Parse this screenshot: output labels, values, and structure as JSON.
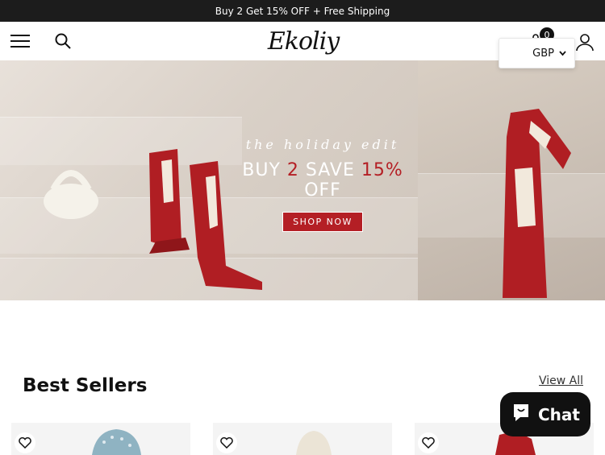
{
  "announcement": {
    "text": "Buy 2 Get 15% OFF + Free Shipping"
  },
  "header": {
    "logo_text": "Ekoliy",
    "cart_count": "0",
    "currency": "GBP"
  },
  "hero": {
    "tagline": "the holiday edit",
    "promo_prefix": "BUY ",
    "promo_number": "2",
    "promo_save": " SAVE ",
    "promo_percent": "15%",
    "promo_suffix": " OFF",
    "cta": "SHOP NOW",
    "accent_color": "#b41f25"
  },
  "best_sellers": {
    "title": "Best Sellers",
    "view_all": "View All"
  },
  "chat": {
    "label": "Chat"
  },
  "icons": [
    "menu-icon",
    "search-icon",
    "cart-icon",
    "user-icon",
    "chevron-down-icon",
    "heart-icon",
    "chat-bubble-icon"
  ]
}
